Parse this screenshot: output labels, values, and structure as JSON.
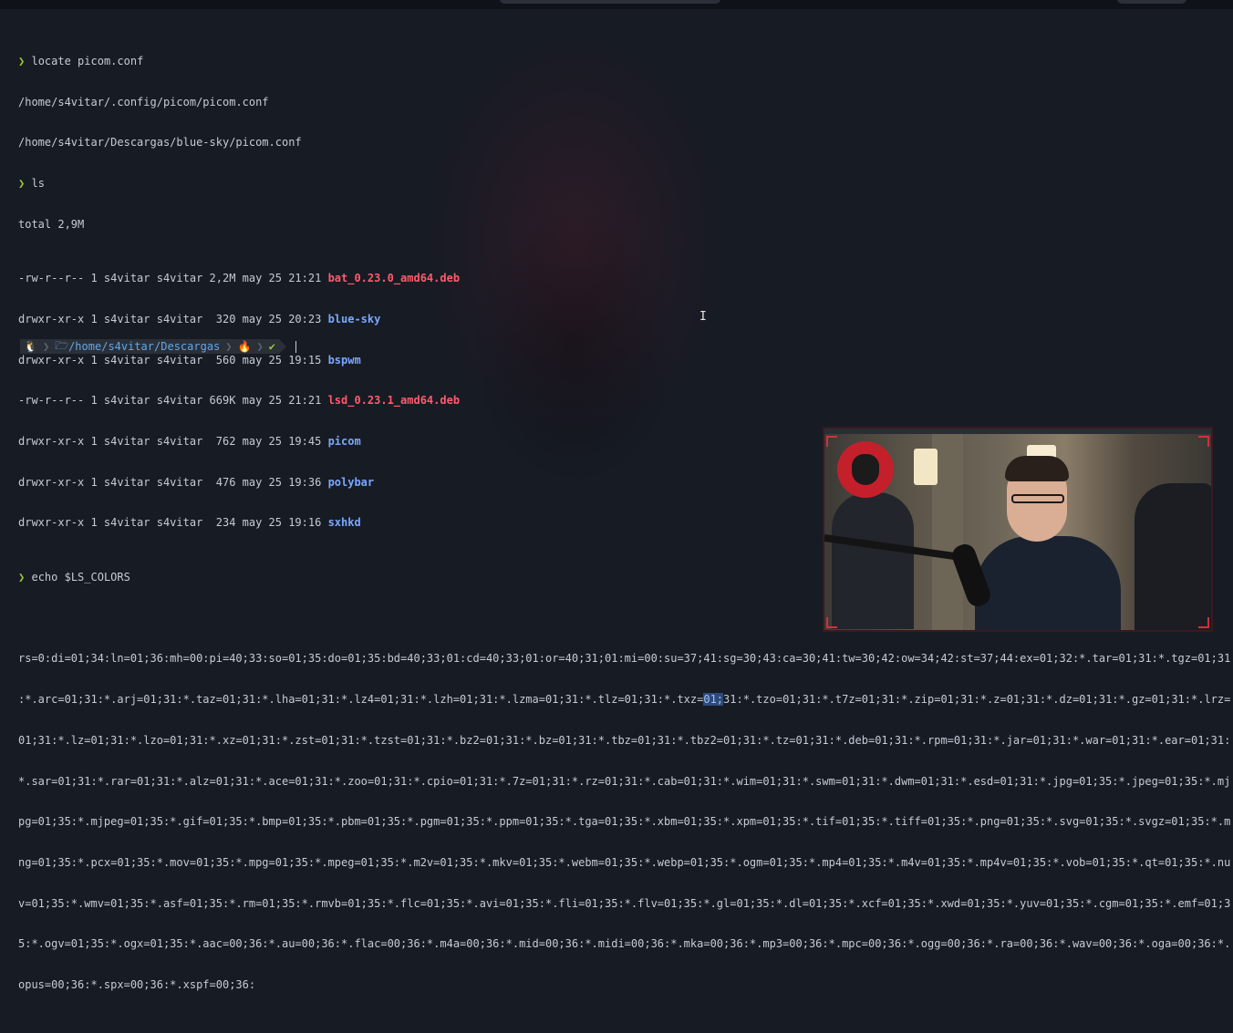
{
  "terminal": {
    "cmd1": {
      "prompt": "❯",
      "command": "locate picom.conf"
    },
    "locate_results": [
      "/home/s4vitar/.config/picom/picom.conf",
      "/home/s4vitar/Descargas/blue-sky/picom.conf"
    ],
    "cmd2": {
      "prompt": "❯",
      "command": "ls"
    },
    "ls_total": "total 2,9M",
    "ls_entries": [
      {
        "meta": "-rw-r--r-- 1 s4vitar s4vitar 2,2M may 25 21:21 ",
        "name": "bat_0.23.0_amd64.deb"
      },
      {
        "meta": "drwxr-xr-x 1 s4vitar s4vitar  320 may 25 20:23 ",
        "name": "blue-sky"
      },
      {
        "meta": "drwxr-xr-x 1 s4vitar s4vitar  560 may 25 19:15 ",
        "name": "bspwm"
      },
      {
        "meta": "-rw-r--r-- 1 s4vitar s4vitar 669K may 25 21:21 ",
        "name": "lsd_0.23.1_amd64.deb"
      },
      {
        "meta": "drwxr-xr-x 1 s4vitar s4vitar  762 may 25 19:45 ",
        "name": "picom"
      },
      {
        "meta": "drwxr-xr-x 1 s4vitar s4vitar  476 may 25 19:36 ",
        "name": "polybar"
      },
      {
        "meta": "drwxr-xr-x 1 s4vitar s4vitar  234 may 25 19:16 ",
        "name": "sxhkd"
      }
    ],
    "cmd3": {
      "prompt": "❯",
      "command": "echo $LS_COLORS"
    },
    "ls_colors": {
      "line1": "rs=0:di=01;34:ln=01;36:mh=00:pi=40;33:so=01;35:do=01;35:bd=40;33;01:cd=40;33;01:or=40;31;01:mi=00:su=37;41:sg=30;43:ca=30;41:tw=30;42:ow=34;42:st=37;44:ex=01;32:*.tar=01;31:*.tgz=01;31",
      "line2_pre": ":*.arc=01;31:*.arj=01;31:*.taz=01;31:*.lha=01;31:*.lz4=01;31:*.lzh=01;31:*.lzma=01;31:*.tlz=01;31:*.txz=",
      "line2_hl": "01;",
      "line2_post": "31:*.tzo=01;31:*.t7z=01;31:*.zip=01;31:*.z=01;31:*.dz=01;31:*.gz=01;31:*.lrz=",
      "line3": "01;31:*.lz=01;31:*.lzo=01;31:*.xz=01;31:*.zst=01;31:*.tzst=01;31:*.bz2=01;31:*.bz=01;31:*.tbz=01;31:*.tbz2=01;31:*.tz=01;31:*.deb=01;31:*.rpm=01;31:*.jar=01;31:*.war=01;31:*.ear=01;31:",
      "line4": "*.sar=01;31:*.rar=01;31:*.alz=01;31:*.ace=01;31:*.zoo=01;31:*.cpio=01;31:*.7z=01;31:*.rz=01;31:*.cab=01;31:*.wim=01;31:*.swm=01;31:*.dwm=01;31:*.esd=01;31:*.jpg=01;35:*.jpeg=01;35:*.mj",
      "line5": "pg=01;35:*.mjpeg=01;35:*.gif=01;35:*.bmp=01;35:*.pbm=01;35:*.pgm=01;35:*.ppm=01;35:*.tga=01;35:*.xbm=01;35:*.xpm=01;35:*.tif=01;35:*.tiff=01;35:*.png=01;35:*.svg=01;35:*.svgz=01;35:*.m",
      "line6": "ng=01;35:*.pcx=01;35:*.mov=01;35:*.mpg=01;35:*.mpeg=01;35:*.m2v=01;35:*.mkv=01;35:*.webm=01;35:*.webp=01;35:*.ogm=01;35:*.mp4=01;35:*.m4v=01;35:*.mp4v=01;35:*.vob=01;35:*.qt=01;35:*.nu",
      "line7": "v=01;35:*.wmv=01;35:*.asf=01;35:*.rm=01;35:*.rmvb=01;35:*.flc=01;35:*.avi=01;35:*.fli=01;35:*.flv=01;35:*.gl=01;35:*.dl=01;35:*.xcf=01;35:*.xwd=01;35:*.yuv=01;35:*.cgm=01;35:*.emf=01;3",
      "line8": "5:*.ogv=01;35:*.ogx=01;35:*.aac=00;36:*.au=00;36:*.flac=00;36:*.m4a=00;36:*.mid=00;36:*.midi=00;36:*.mka=00;36:*.mp3=00;36:*.mpc=00;36:*.ogg=00;36:*.ra=00;36:*.wav=00;36:*.oga=00;36:*.",
      "line9": "opus=00;36:*.spx=00;36:*.xspf=00;36:"
    }
  },
  "statusline": {
    "os_icon": "🐧",
    "folder_icon": "🗁",
    "path_prefix": "/home/",
    "path_user": "s4vitar",
    "path_sep": "/",
    "path_dir": "Descargas",
    "flame_icon": "🔥",
    "check_icon": "✔",
    "separator": "❯"
  },
  "colors": {
    "background": "#171b24",
    "prompt": "#9ccc30",
    "deb_file": "#ff5b6b",
    "directory": "#7aa8ff",
    "path": "#5fa8e8",
    "accent": "#d0313c"
  }
}
